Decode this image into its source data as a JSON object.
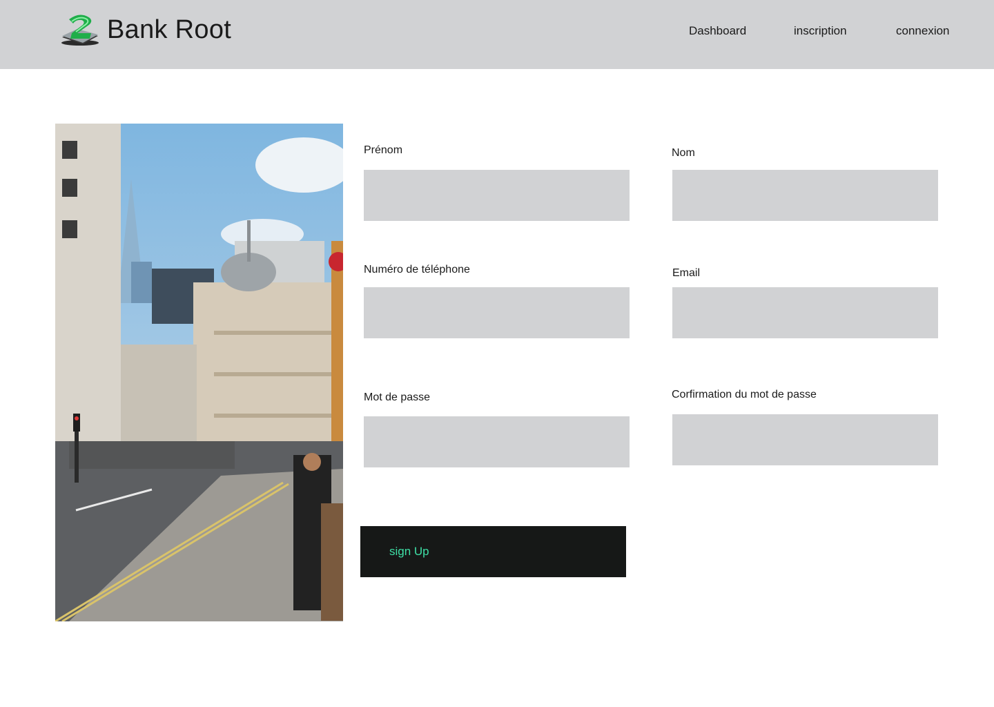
{
  "header": {
    "brand": "Bank Root",
    "logo_icon": "bank-root-logo-icon",
    "nav": [
      {
        "label": "Dashboard"
      },
      {
        "label": "inscription"
      },
      {
        "label": "connexion"
      }
    ]
  },
  "photo": {
    "icon": "city-street-photo"
  },
  "form": {
    "first_name": {
      "label": "Prénom",
      "value": ""
    },
    "last_name": {
      "label": "Nom",
      "value": ""
    },
    "phone": {
      "label": "Numéro de téléphone",
      "value": ""
    },
    "email": {
      "label": "Email",
      "value": ""
    },
    "password": {
      "label": "Mot de passe",
      "value": ""
    },
    "password_confirm": {
      "label": "Corfirmation du mot de passe",
      "value": ""
    },
    "submit_label": "sign Up"
  },
  "colors": {
    "header_bg": "#d1d2d4",
    "input_bg": "#d1d2d4",
    "button_bg": "#161817",
    "button_text": "#3ee0a6"
  }
}
